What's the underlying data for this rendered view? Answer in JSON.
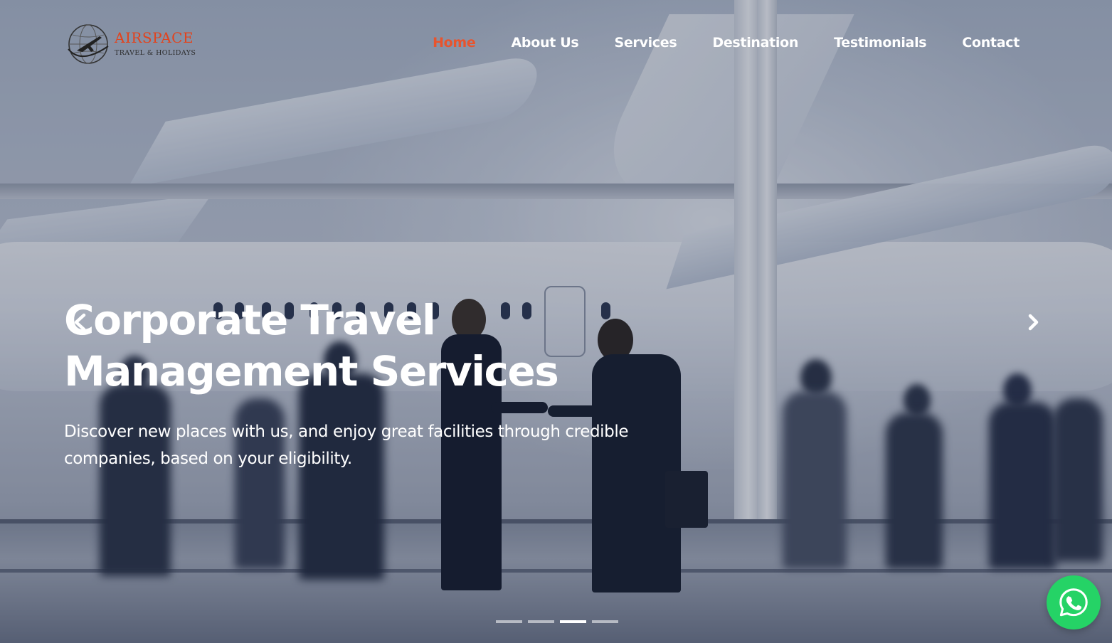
{
  "logo": {
    "name": "AIRSPACE",
    "tagline": "TRAVEL & HOLIDAYS",
    "color": "#e2431d"
  },
  "nav": {
    "items": [
      {
        "label": "Home",
        "active": true
      },
      {
        "label": "About Us",
        "active": false
      },
      {
        "label": "Services",
        "active": false
      },
      {
        "label": "Destination",
        "active": false
      },
      {
        "label": "Testimonials",
        "active": false
      },
      {
        "label": "Contact",
        "active": false
      }
    ],
    "active_color": "#e8542d"
  },
  "hero": {
    "headline_line1": "Corporate Travel",
    "headline_line2": "Management Services",
    "subtext": "Discover new places with us, and enjoy great facilities through credible companies, based on your eligibility.",
    "prev_icon": "chevron-left-icon",
    "next_icon": "chevron-right-icon"
  },
  "carousel": {
    "slide_count": 4,
    "active_index": 2
  },
  "whatsapp": {
    "icon": "whatsapp-icon",
    "color": "#25d366"
  }
}
